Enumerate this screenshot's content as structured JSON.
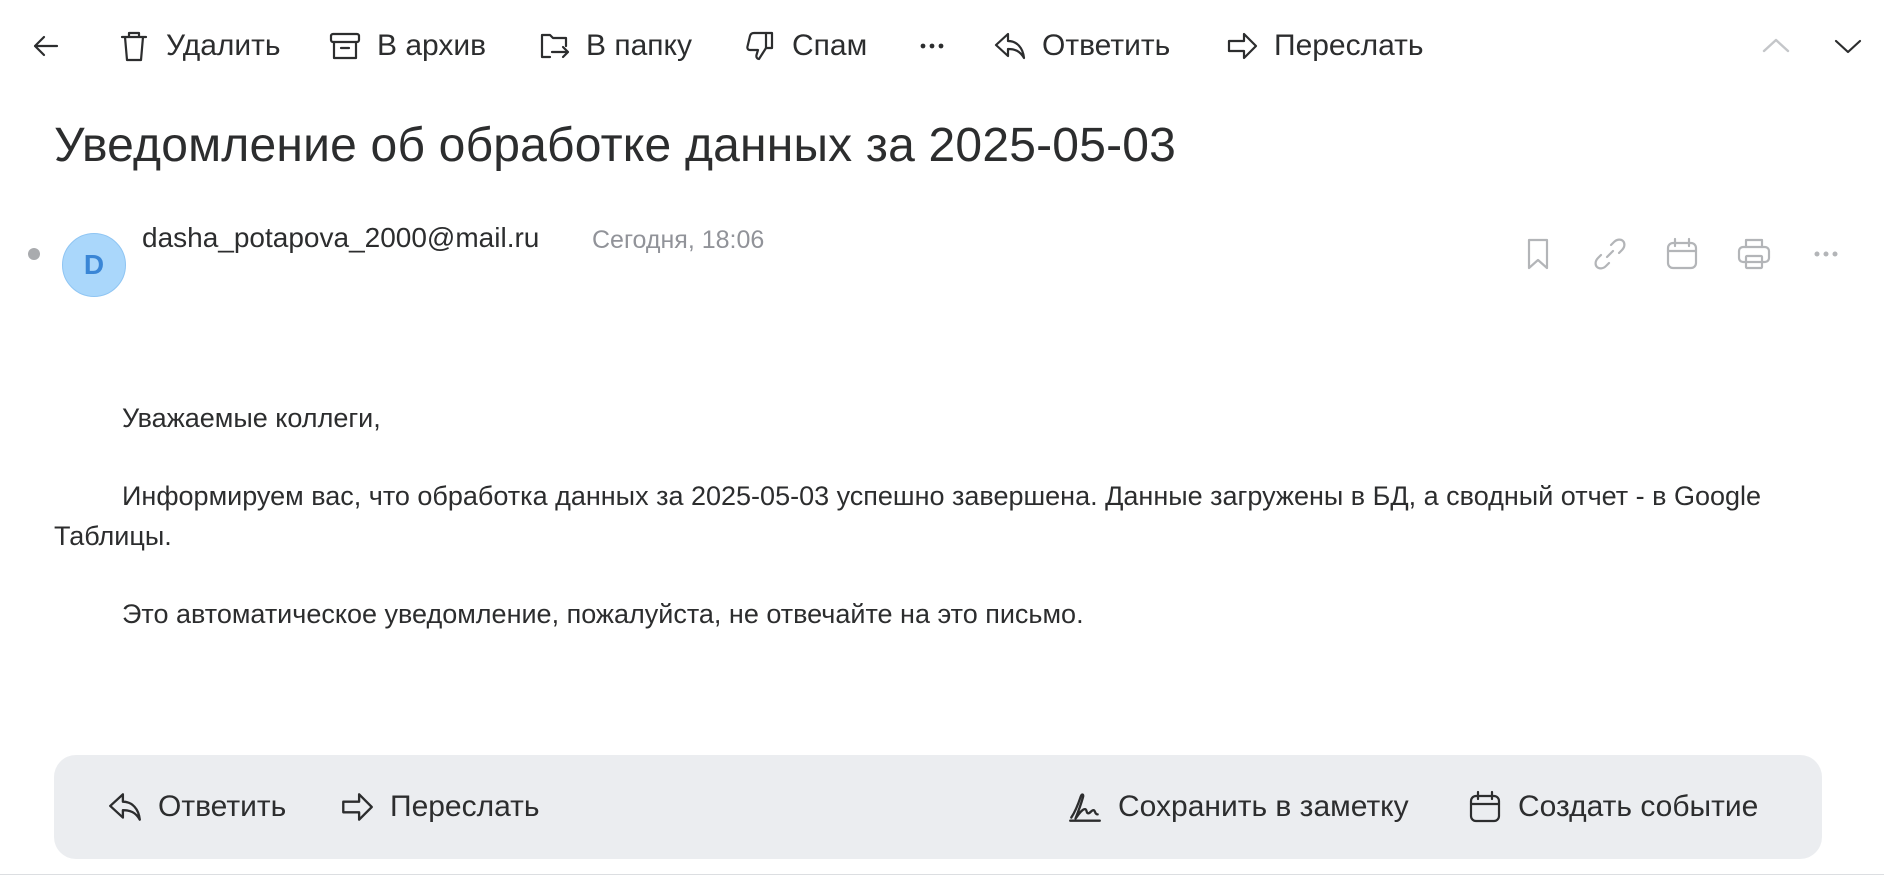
{
  "toolbar": {
    "delete_label": "Удалить",
    "archive_label": "В архив",
    "move_label": "В папку",
    "spam_label": "Спам",
    "reply_label": "Ответить",
    "forward_label": "Переслать"
  },
  "message": {
    "subject": "Уведомление об обработке данных за 2025-05-03",
    "sender": {
      "avatar_letter": "D",
      "email": "dasha_potapova_2000@mail.ru",
      "date": "Сегодня, 18:06"
    },
    "body": [
      "Уважаемые коллеги,",
      "Информируем вас, что обработка данных за 2025-05-03 успешно завершена. Данные загружены в БД, а сводный отчет - в Google Таблицы.",
      "Это автоматическое уведомление, пожалуйста, не отвечайте на это письмо."
    ]
  },
  "bottom_bar": {
    "reply_label": "Ответить",
    "forward_label": "Переслать",
    "save_note_label": "Сохранить в заметку",
    "create_event_label": "Создать событие"
  },
  "colors": {
    "avatar_bg": "#aad7fb",
    "avatar_text": "#3a86d6",
    "bottom_bar_bg": "#ebedf0",
    "date_text": "#919399"
  },
  "icons": [
    "back-arrow-icon",
    "trash-icon",
    "archive-icon",
    "folder-move-icon",
    "thumbs-down-icon",
    "more-horizontal-icon",
    "reply-icon",
    "forward-icon",
    "chevron-up-icon",
    "chevron-down-icon",
    "bookmark-icon",
    "link-icon",
    "calendar-icon",
    "printer-icon",
    "signature-icon"
  ]
}
